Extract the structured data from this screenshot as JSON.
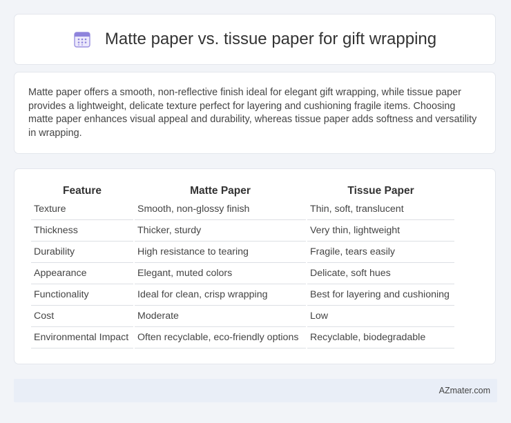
{
  "header": {
    "icon": "calendar-icon",
    "title": "Matte paper vs. tissue paper for gift wrapping"
  },
  "intro": {
    "text": "Matte paper offers a smooth, non-reflective finish ideal for elegant gift wrapping, while tissue paper provides a lightweight, delicate texture perfect for layering and cushioning fragile items. Choosing matte paper enhances visual appeal and durability, whereas tissue paper adds softness and versatility in wrapping."
  },
  "table": {
    "headers": [
      "Feature",
      "Matte Paper",
      "Tissue Paper"
    ],
    "rows": [
      [
        "Texture",
        "Smooth, non-glossy finish",
        "Thin, soft, translucent"
      ],
      [
        "Thickness",
        "Thicker, sturdy",
        "Very thin, lightweight"
      ],
      [
        "Durability",
        "High resistance to tearing",
        "Fragile, tears easily"
      ],
      [
        "Appearance",
        "Elegant, muted colors",
        "Delicate, soft hues"
      ],
      [
        "Functionality",
        "Ideal for clean, crisp wrapping",
        "Best for layering and cushioning"
      ],
      [
        "Cost",
        "Moderate",
        "Low"
      ],
      [
        "Environmental Impact",
        "Often recyclable, eco-friendly options",
        "Recyclable, biodegradable"
      ]
    ]
  },
  "footer": {
    "brand": "AZmater.com"
  },
  "colors": {
    "background": "#f2f4f8",
    "card": "#ffffff",
    "footer": "#e9eef7",
    "icon_accent": "#7b6fd6"
  }
}
